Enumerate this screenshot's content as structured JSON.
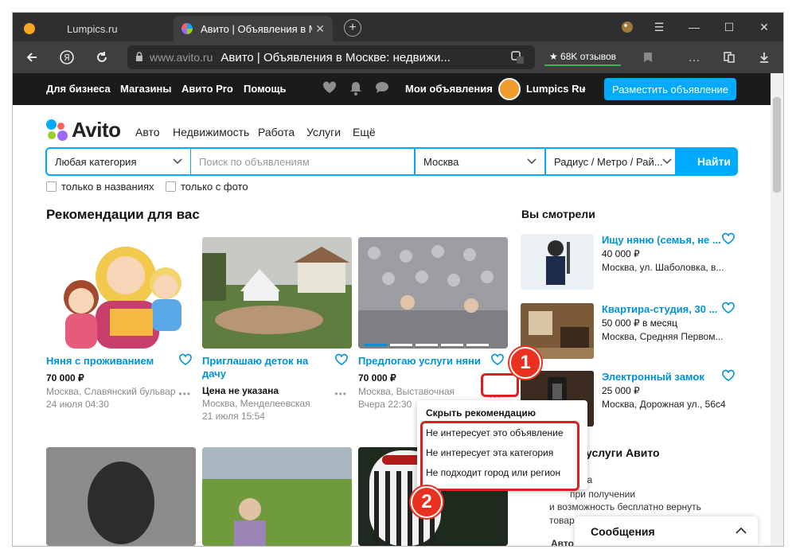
{
  "browser": {
    "tabs": [
      {
        "label": "Lumpics.ru"
      },
      {
        "label": "Авито | Объявления в М"
      }
    ],
    "new_tab": "+",
    "url_domain": "www.avito.ru",
    "page_title": "Авито | Объявления в Москве: недвижи...",
    "reviews_badge": "★ 68K отзывов",
    "tab_close": "✕",
    "controls": {
      "more": "☰",
      "minimize": "—",
      "maximize": "☐",
      "close": "✕"
    }
  },
  "avito_header": {
    "links": [
      "Для бизнеса",
      "Магазины",
      "Авито Pro",
      "Помощь"
    ],
    "my_ads": "Мои объявления",
    "user_name": "Lumpics Ru",
    "post_button": "Разместить объявление"
  },
  "logo": {
    "text": "Avito"
  },
  "menu": [
    "Авто",
    "Недвижимость",
    "Работа",
    "Услуги",
    "Ещё"
  ],
  "search": {
    "category": "Любая категория",
    "placeholder": "Поиск по объявлениям",
    "city": "Москва",
    "radius": "Радиус / Метро / Рай...",
    "button": "Найти",
    "only_titles": "только в названиях",
    "only_photo": "только с фото"
  },
  "recommendations": {
    "title": "Рекомендации для вас",
    "cards": [
      {
        "title": "Няня с проживанием",
        "price": "70 000 ₽",
        "location": "Москва, Славянский бульвар",
        "date": "24 июля 04:30"
      },
      {
        "title": "Приглашаю деток на дачу",
        "price": "Цена не указана",
        "location": "Москва, Менделеевская",
        "date": "21 июля 15:54"
      },
      {
        "title": "Предлогаю услуги няни",
        "price": "70 000 ₽",
        "location": "Москва, Выставочная",
        "date": "Вчера 22:30"
      }
    ],
    "more": "•••"
  },
  "viewed": {
    "title": "Вы смотрели",
    "items": [
      {
        "title": "Ищу няню (семья, не ...",
        "price": "40 000 ₽",
        "location": "Москва, ул. Шаболовка, в..."
      },
      {
        "title": "Квартира-студия, 30 ...",
        "price": "50 000 ₽ в месяц",
        "location": "Москва, Средняя Первом..."
      },
      {
        "title": "Электронный замок",
        "price": "25 000 ₽",
        "location": "Москва, Дорожная ул., 56с4"
      }
    ]
  },
  "context_menu": {
    "items": [
      "Скрыть рекомендацию",
      "Не интересует это объявление",
      "Не интересует эта категория",
      "Не подходит город или регион"
    ]
  },
  "badges": {
    "step1": "1",
    "step2": "2"
  },
  "services": {
    "title": "услуги Авито",
    "lines": [
      "ка",
      "при получении",
      "и возможность бесплатно вернуть",
      "товар",
      "Авто"
    ]
  },
  "messages": {
    "label": "Сообщения"
  },
  "colors": {
    "accent": "#00aaff",
    "link": "#0091d9",
    "highlight": "#e02020"
  }
}
